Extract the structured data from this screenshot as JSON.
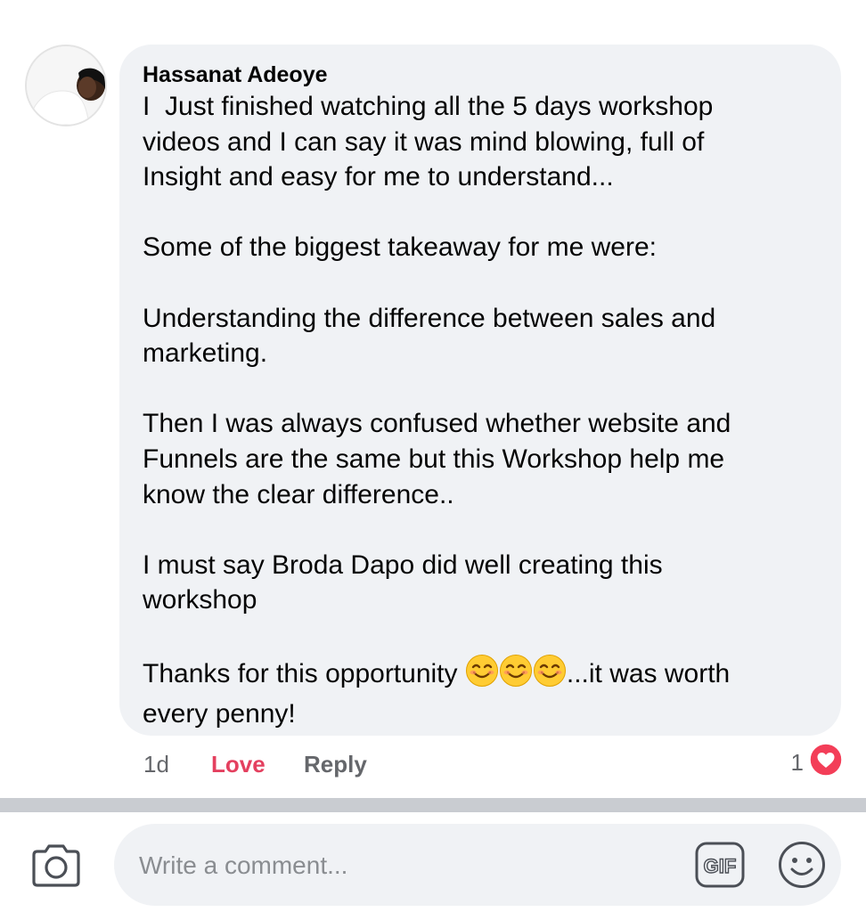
{
  "comment": {
    "author": "Hassanat Adeoye",
    "body_parts": [
      "I  Just finished watching all the 5 days workshop\nvideos and I can say it was mind blowing, full of\nInsight and easy for me to understand...\n\nSome of the biggest takeaway for me were:\n\nUnderstanding the difference between sales and\nmarketing.\n\nThen I was always confused whether website and\nFunnels are the same but this Workshop help me\nknow the clear difference..\n\nI must say Broda Dapo did well creating this\nworkshop\n\nThanks for this opportunity ",
      "...it was worth\nevery penny!"
    ],
    "emojis": [
      "smiling-face-with-smiling-eyes",
      "smiling-face-with-smiling-eyes",
      "smiling-face-with-smiling-eyes"
    ],
    "time": "1d",
    "love_label": "Love",
    "reply_label": "Reply",
    "reaction_count": "1",
    "reaction_icon": "heart-icon"
  },
  "composer": {
    "placeholder": "Write a comment...",
    "camera_icon": "camera-icon",
    "gif_label": "GIF",
    "emoji_icon": "smiley-icon"
  },
  "colors": {
    "bubble_bg": "#f0f2f5",
    "love": "#e4405f",
    "heart": "#f33e58",
    "muted": "#65676b",
    "divider": "#c9ccd1"
  }
}
